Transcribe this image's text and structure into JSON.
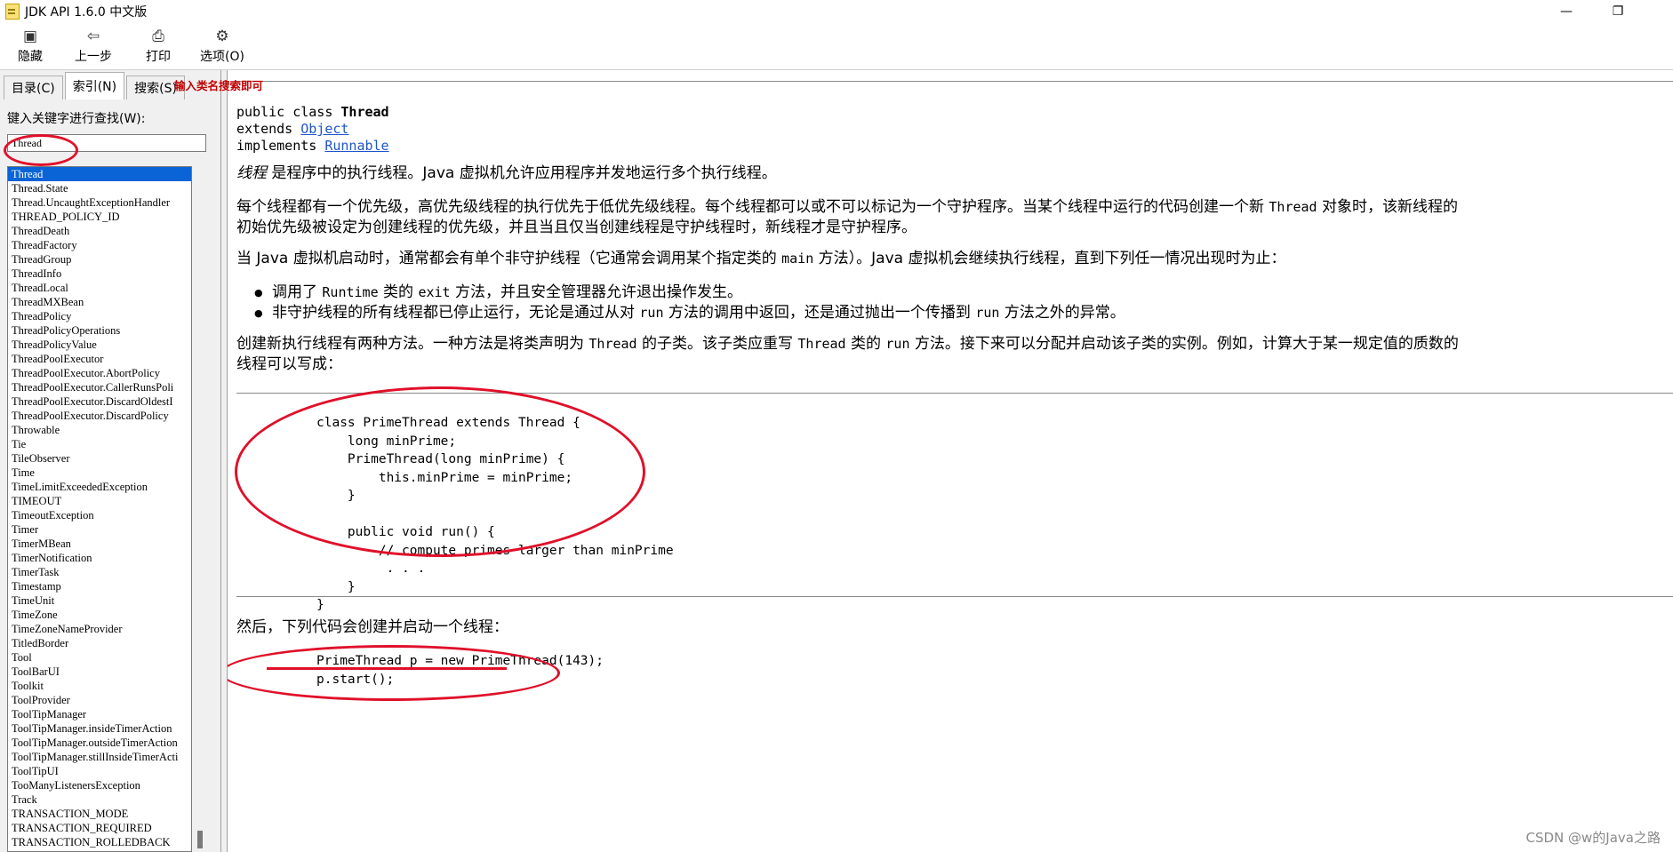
{
  "window": {
    "title": "JDK API 1.6.0 中文版",
    "minimize_icon": "minimize-icon",
    "restore_icon": "restore-icon"
  },
  "toolbar": {
    "hide_label": "隐藏",
    "back_label": "上一步",
    "print_label": "打印",
    "options_label": "选项(O)"
  },
  "left": {
    "tabs": [
      "目录(C)",
      "索引(N)",
      "搜索(S)"
    ],
    "active_tab": "索引(N)",
    "keyword_label": "键入关键字进行查找(W):",
    "keyword_value": "Thread",
    "annotation": "输入类名搜索即可",
    "items": [
      "Thread",
      "Thread.State",
      "Thread.UncaughtExceptionHandler",
      "THREAD_POLICY_ID",
      "ThreadDeath",
      "ThreadFactory",
      "ThreadGroup",
      "ThreadInfo",
      "ThreadLocal",
      "ThreadMXBean",
      "ThreadPolicy",
      "ThreadPolicyOperations",
      "ThreadPolicyValue",
      "ThreadPoolExecutor",
      "ThreadPoolExecutor.AbortPolicy",
      "ThreadPoolExecutor.CallerRunsPoli",
      "ThreadPoolExecutor.DiscardOldestI",
      "ThreadPoolExecutor.DiscardPolicy",
      "Throwable",
      "Tie",
      "TileObserver",
      "Time",
      "TimeLimitExceededException",
      "TIMEOUT",
      "TimeoutException",
      "Timer",
      "TimerMBean",
      "TimerNotification",
      "TimerTask",
      "Timestamp",
      "TimeUnit",
      "TimeZone",
      "TimeZoneNameProvider",
      "TitledBorder",
      "Tool",
      "ToolBarUI",
      "Toolkit",
      "ToolProvider",
      "ToolTipManager",
      "ToolTipManager.insideTimerAction",
      "ToolTipManager.outsideTimerAction",
      "ToolTipManager.stillInsideTimerActi",
      "ToolTipUI",
      "TooManyListenersException",
      "Track",
      "TRANSACTION_MODE",
      "TRANSACTION_REQUIRED",
      "TRANSACTION_ROLLEDBACK"
    ],
    "selected_item": "Thread"
  },
  "content": {
    "decl_line1_prefix": "public class ",
    "decl_class": "Thread",
    "decl_line2_prefix": "extends ",
    "decl_extends": "Object",
    "decl_line3_prefix": "implements ",
    "decl_implements": "Runnable",
    "p1_em": "线程",
    "p1_rest": " 是程序中的执行线程。Java 虚拟机允许应用程序并发地运行多个执行线程。",
    "p2_a": "每个线程都有一个优先级，高优先级线程的执行优先于低优先级线程。每个线程都可以或不可以标记为一个守护程序。当某个线程中运行的代码创建一个新 ",
    "p2_code": "Thread",
    "p2_b": " 对象时，该新线程的",
    "p2_line2": "初始优先级被设定为创建线程的优先级，并且当且仅当创建线程是守护线程时，新线程才是守护程序。",
    "p3_a": "当 Java 虚拟机启动时，通常都会有单个非守护线程（它通常会调用某个指定类的 ",
    "p3_code": "main",
    "p3_b": " 方法）。Java 虚拟机会继续执行线程，直到下列任一情况出现时为止：",
    "b1_a": "调用了 ",
    "b1_code1": "Runtime",
    "b1_b": " 类的 ",
    "b1_code2": "exit",
    "b1_c": " 方法，并且安全管理器允许退出操作发生。",
    "b2_a": "非守护线程的所有线程都已停止运行，无论是通过从对 ",
    "b2_code1": "run",
    "b2_b": " 方法的调用中返回，还是通过抛出一个传播到 ",
    "b2_code2": "run",
    "b2_c": " 方法之外的异常。",
    "p4_a": "创建新执行线程有两种方法。一种方法是将类声明为 ",
    "p4_code1": "Thread",
    "p4_b": " 的子类。该子类应重写 ",
    "p4_code2": "Thread",
    "p4_c": " 类的 ",
    "p4_code3": "run",
    "p4_d": " 方法。接下来可以分配并启动该子类的实例。例如，计算大于某一规定值的质数的",
    "p4_line2": "线程可以写成：",
    "code1": "class PrimeThread extends Thread {\n    long minPrime;\n    PrimeThread(long minPrime) {\n        this.minPrime = minPrime;\n    }\n\n    public void run() {\n        // compute primes larger than minPrime\n         . . .\n    }\n}",
    "p5": "然后，下列代码会创建并启动一个线程：",
    "code2": "PrimeThread p = new PrimeThread(143);\np.start();"
  },
  "watermark": "CSDN @w的Java之路",
  "colors": {
    "selection": "#0a64d6",
    "annotation_red": "#e0102a",
    "link": "#1f55c8"
  }
}
